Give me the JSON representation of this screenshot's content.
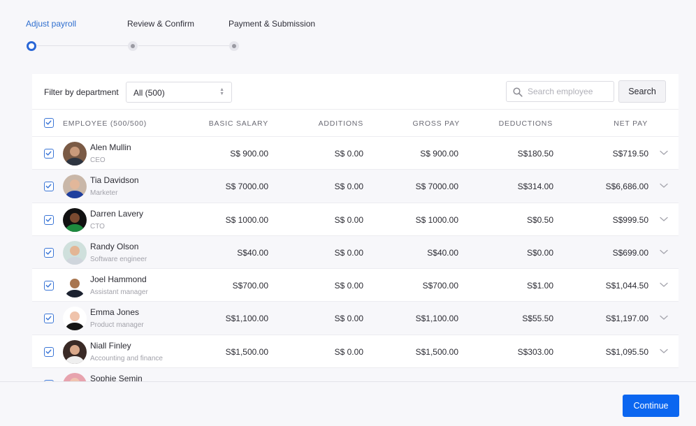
{
  "stepper": {
    "steps": [
      {
        "label": "Adjust payroll",
        "state": "active"
      },
      {
        "label": "Review & Confirm",
        "state": "pending"
      },
      {
        "label": "Payment & Submission",
        "state": "pending"
      }
    ]
  },
  "toolbar": {
    "filter_label": "Filter by department",
    "department_select": "All (500)",
    "search_placeholder": "Search employee",
    "search_value": "",
    "search_button": "Search"
  },
  "table": {
    "columns": {
      "employee": "EMPLOYEE (500/500)",
      "basic_salary": "BASIC SALARY",
      "additions": "ADDITIONS",
      "gross_pay": "GROSS PAY",
      "deductions": "DEDUCTIONS",
      "net_pay": "NET PAY"
    },
    "select_all_checked": true,
    "rows": [
      {
        "name": "Alen Mullin",
        "role": "CEO",
        "basic": "S$ 900.00",
        "additions": "S$ 0.00",
        "gross": "S$ 900.00",
        "deductions": "S$180.50",
        "net": "S$719.50",
        "checked": true
      },
      {
        "name": "Tia Davidson",
        "role": "Marketer",
        "basic": "S$ 7000.00",
        "additions": "S$ 0.00",
        "gross": "S$ 7000.00",
        "deductions": "S$314.00",
        "net": "S$6,686.00",
        "checked": true
      },
      {
        "name": "Darren Lavery",
        "role": "CTO",
        "basic": "S$ 1000.00",
        "additions": "S$ 0.00",
        "gross": "S$ 1000.00",
        "deductions": "S$0.50",
        "net": "S$999.50",
        "checked": true
      },
      {
        "name": "Randy Olson",
        "role": "Software engineer",
        "basic": "S$40.00",
        "additions": "S$ 0.00",
        "gross": "S$40.00",
        "deductions": "S$0.00",
        "net": "S$699.00",
        "checked": true
      },
      {
        "name": "Joel Hammond",
        "role": "Assistant manager",
        "basic": "S$700.00",
        "additions": "S$ 0.00",
        "gross": "S$700.00",
        "deductions": "S$1.00",
        "net": "S$1,044.50",
        "checked": true
      },
      {
        "name": "Emma Jones",
        "role": "Product manager",
        "basic": "S$1,100.00",
        "additions": "S$ 0.00",
        "gross": "S$1,100.00",
        "deductions": "S$55.50",
        "net": "S$1,197.00",
        "checked": true
      },
      {
        "name": "Niall Finley",
        "role": "Accounting and finance",
        "basic": "S$1,500.00",
        "additions": "S$ 0.00",
        "gross": "S$1,500.00",
        "deductions": "S$303.00",
        "net": "S$1,095.50",
        "checked": true
      },
      {
        "name": "Sophie Semin",
        "role": "",
        "basic": "",
        "additions": "",
        "gross": "",
        "deductions": "",
        "net": "",
        "checked": true
      }
    ]
  },
  "footer": {
    "continue_button": "Continue"
  },
  "colors": {
    "accent": "#0b66f0",
    "step_active": "#2a67d6",
    "checkbox": "#3b76d6"
  }
}
